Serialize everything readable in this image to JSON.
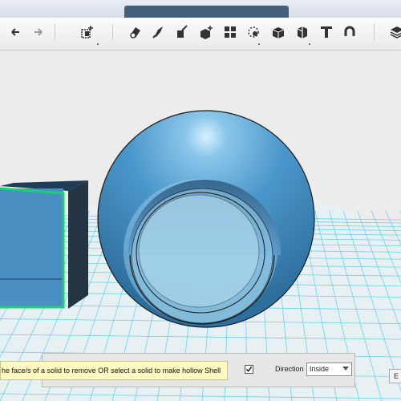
{
  "toolbar": {
    "buttons": [
      {
        "name": "undo-button",
        "icon": "undo-icon"
      },
      {
        "name": "redo-button",
        "icon": "redo-icon"
      },
      {
        "name": "add-primitive-button",
        "icon": "add-box-icon"
      },
      {
        "name": "sketch-tool-button",
        "icon": "sketch-icon"
      },
      {
        "name": "construct-tool-button",
        "icon": "brush-icon"
      },
      {
        "name": "modify-tool-button",
        "icon": "paint-icon"
      },
      {
        "name": "modify-plus-tool-button",
        "icon": "plus-box-icon"
      },
      {
        "name": "pattern-tool-button",
        "icon": "pattern-icon"
      },
      {
        "name": "snap-tool-button",
        "icon": "snap-icon"
      },
      {
        "name": "group-tool-button",
        "icon": "solid-box-icon"
      },
      {
        "name": "material-tool-button",
        "icon": "split-box-icon"
      },
      {
        "name": "text-tool-button",
        "icon": "text-icon"
      },
      {
        "name": "measure-tool-button",
        "icon": "magnet-icon"
      },
      {
        "name": "layers-button",
        "icon": "layers-icon"
      }
    ]
  },
  "shell": {
    "hint": "he face/s of a solid to remove OR select a solid to make hollow Shell",
    "checkbox_checked": true,
    "direction_label": "Direction",
    "direction_value": "Inside",
    "corner_button_label": "E"
  },
  "colors": {
    "solid_blue": "#4a8fc2",
    "selection_green": "#1ecf73",
    "grid_cyan": "#6fd0e6"
  }
}
